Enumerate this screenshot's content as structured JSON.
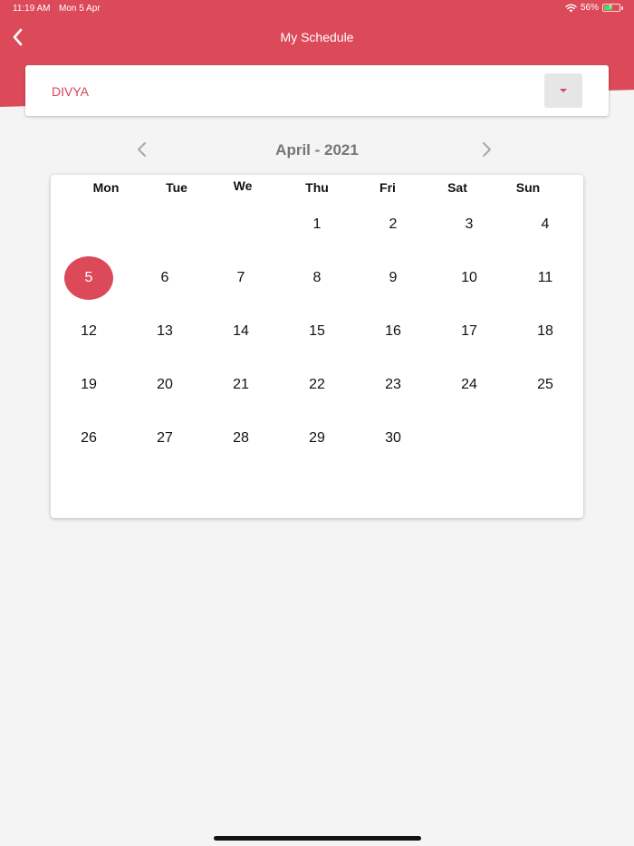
{
  "status_bar": {
    "time": "11:19 AM",
    "date": "Mon 5 Apr",
    "battery_percent_label": "56%",
    "battery_level": 0.56,
    "wifi_icon": "wifi-icon",
    "battery_icon": "battery-charging-icon"
  },
  "header": {
    "title": "My Schedule",
    "back_icon": "chevron-left-icon"
  },
  "dropdown": {
    "selected_value": "DIVYA",
    "caret_icon": "caret-down-icon"
  },
  "month_nav": {
    "label": "April - 2021",
    "prev_icon": "chevron-left-icon",
    "next_icon": "chevron-right-icon"
  },
  "calendar": {
    "weekdays": [
      "Mon",
      "Tue",
      "We",
      "Thu",
      "Fri",
      "Sat",
      "Sun"
    ],
    "weekday_truncated_index": 2,
    "first_day_column": 3,
    "days_in_month": 30,
    "selected_day": 5
  },
  "colors": {
    "accent": "#dc4a5a",
    "accent_text": "#d9435a",
    "page_background": "#f4f4f4",
    "month_label": "#767676"
  }
}
